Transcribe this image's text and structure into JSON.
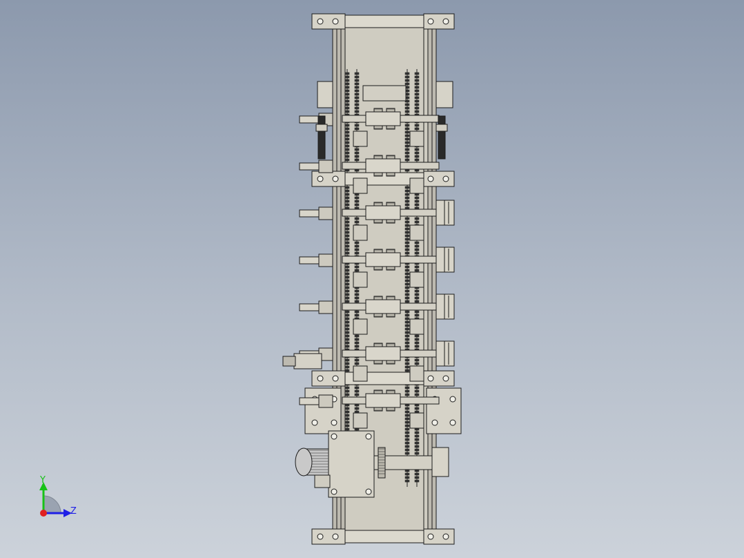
{
  "viewport": {
    "background_top": "#8c99ad",
    "background_bottom": "#ccd2da"
  },
  "model": {
    "name": "",
    "part_fill": "#d6d3c8",
    "part_stroke": "#1b1b1b",
    "chain_color": "#3a3a3a",
    "motor_fill": "#c9c9c9"
  },
  "triad": {
    "x_label": "",
    "y_label": "Y",
    "z_label": "Z",
    "y_color": "#17c217",
    "z_color": "#1f1fe6",
    "x_color": "#e02020"
  }
}
